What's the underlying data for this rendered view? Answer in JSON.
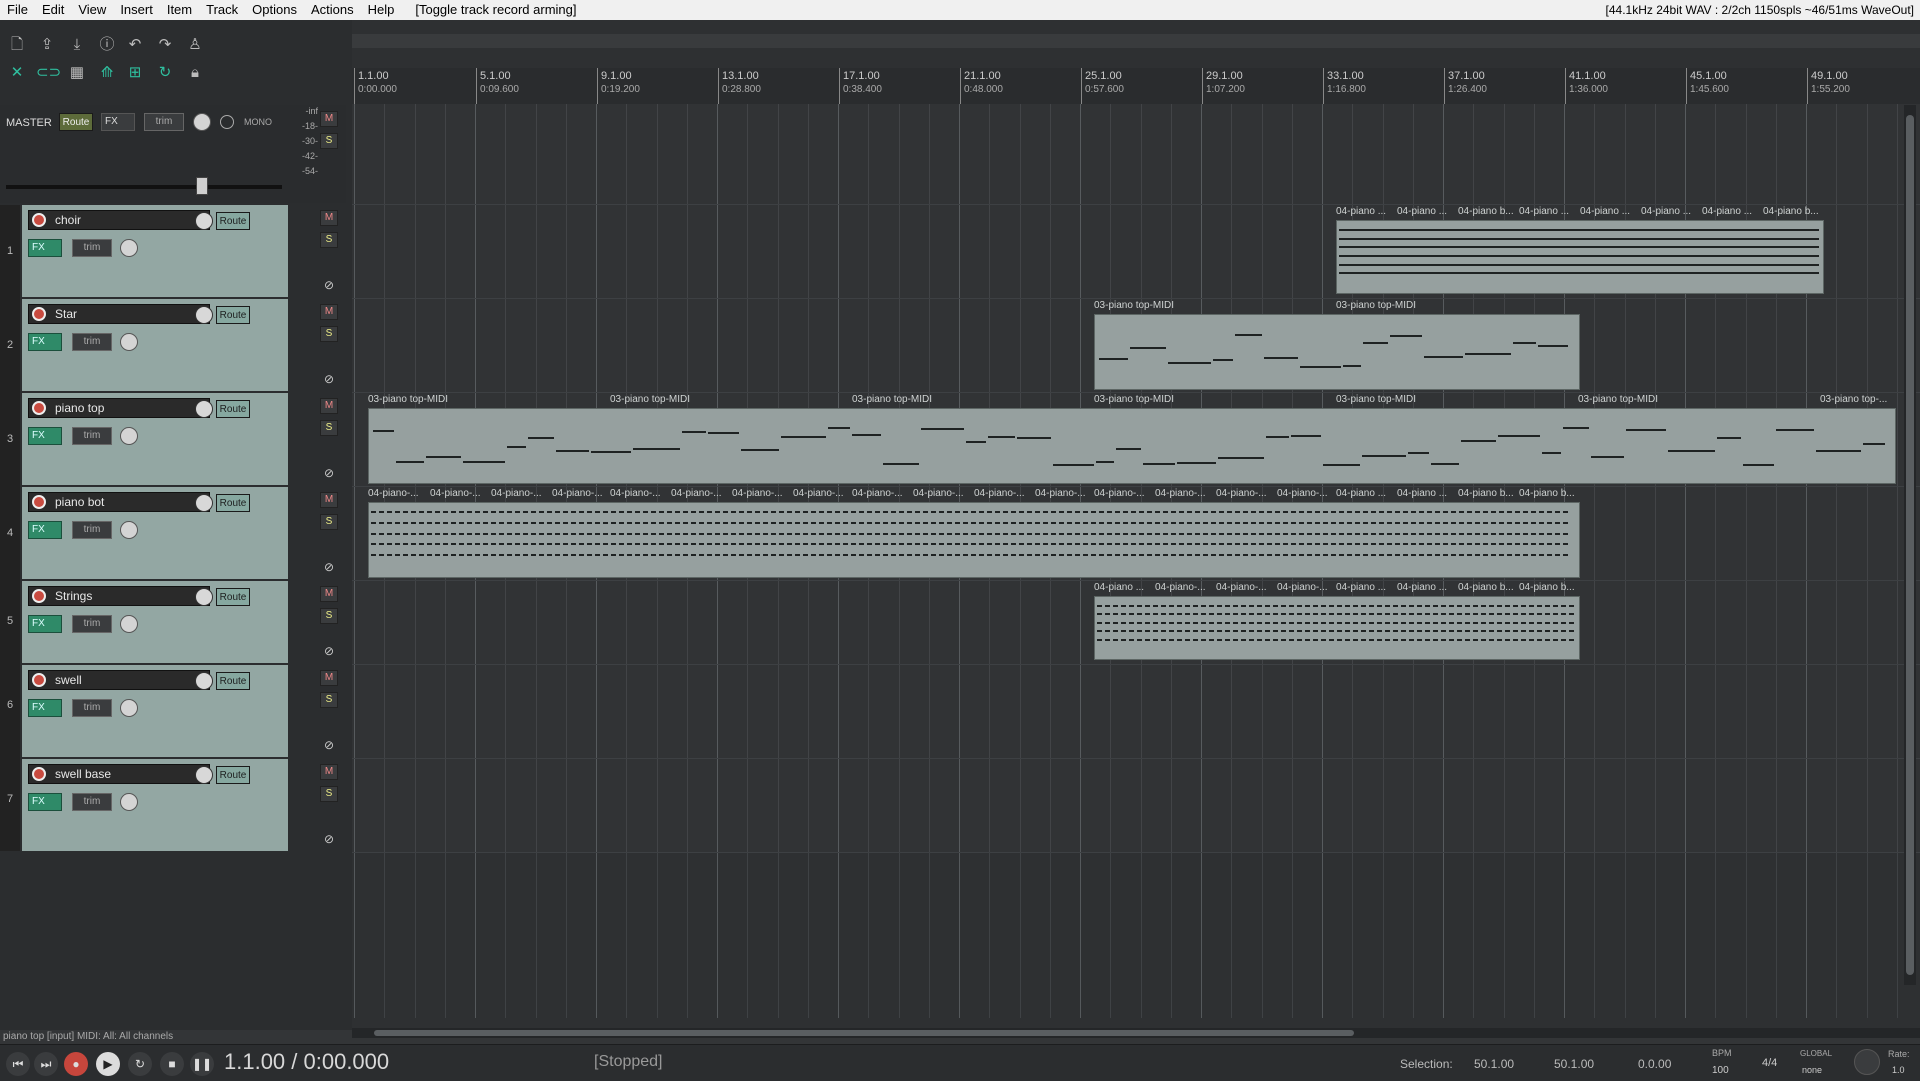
{
  "menubar": {
    "items": [
      "File",
      "Edit",
      "View",
      "Insert",
      "Item",
      "Track",
      "Options",
      "Actions",
      "Help"
    ],
    "last_action": "[Toggle track record arming]",
    "status": "[44.1kHz 24bit WAV : 2/2ch 1150spls ~46/51ms WaveOut]"
  },
  "toolbar": {
    "row1": [
      "new-project-icon",
      "open-project-icon",
      "save-project-icon",
      "info-icon",
      "undo-icon",
      "redo-icon",
      "metronome-icon"
    ],
    "row2": [
      "ripple-icon",
      "link-icon",
      "grid-icon",
      "envelope-icon",
      "snap-icon",
      "loop-icon",
      "lock-icon"
    ]
  },
  "master": {
    "label": "MASTER",
    "route": "Route",
    "fx": "FX",
    "trim": "trim",
    "mono": "MONO",
    "meter_scale": [
      "-inf",
      "-18-",
      "-30-",
      "-42-",
      "-54-"
    ]
  },
  "track_buttons": {
    "mute": "M",
    "solo": "S",
    "phase": "⊘",
    "route": "Route",
    "fx": "FX",
    "trim": "trim"
  },
  "tracks": [
    {
      "num": "1",
      "name": "choir"
    },
    {
      "num": "2",
      "name": "Star"
    },
    {
      "num": "3",
      "name": "piano top"
    },
    {
      "num": "4",
      "name": "piano bot"
    },
    {
      "num": "5",
      "name": "Strings"
    },
    {
      "num": "6",
      "name": "swell"
    },
    {
      "num": "7",
      "name": "swell base"
    }
  ],
  "ruler": [
    {
      "bar": "1.1.00",
      "time": "0:00.000"
    },
    {
      "bar": "5.1.00",
      "time": "0:09.600"
    },
    {
      "bar": "9.1.00",
      "time": "0:19.200"
    },
    {
      "bar": "13.1.00",
      "time": "0:28.800"
    },
    {
      "bar": "17.1.00",
      "time": "0:38.400"
    },
    {
      "bar": "21.1.00",
      "time": "0:48.000"
    },
    {
      "bar": "25.1.00",
      "time": "0:57.600"
    },
    {
      "bar": "29.1.00",
      "time": "1:07.200"
    },
    {
      "bar": "33.1.00",
      "time": "1:16.800"
    },
    {
      "bar": "37.1.00",
      "time": "1:26.400"
    },
    {
      "bar": "41.1.00",
      "time": "1:36.000"
    },
    {
      "bar": "45.1.00",
      "time": "1:45.600"
    },
    {
      "bar": "49.1.00",
      "time": "1:55.200"
    }
  ],
  "item_labels": {
    "piano_top_midi": "03-piano top-MIDI",
    "piano_top_midi_cut": "03-piano top-...",
    "piano_short": "04-piano ...",
    "piano_b": "04-piano b...",
    "piano_short2": "04-piano-..."
  },
  "statusbar": {
    "text": "piano top [input] MIDI: All: All channels"
  },
  "transport": {
    "position": "1.1.00 / 0:00.000",
    "state": "[Stopped]",
    "selection_label": "Selection:",
    "sel_start": "50.1.00",
    "sel_end": "50.1.00",
    "sel_len": "0.0.00",
    "bpm_label": "BPM",
    "bpm": "100",
    "timesig": "4/4",
    "global_label": "GLOBAL",
    "none_label": "none",
    "rate_label": "Rate:",
    "rate": "1.0"
  }
}
